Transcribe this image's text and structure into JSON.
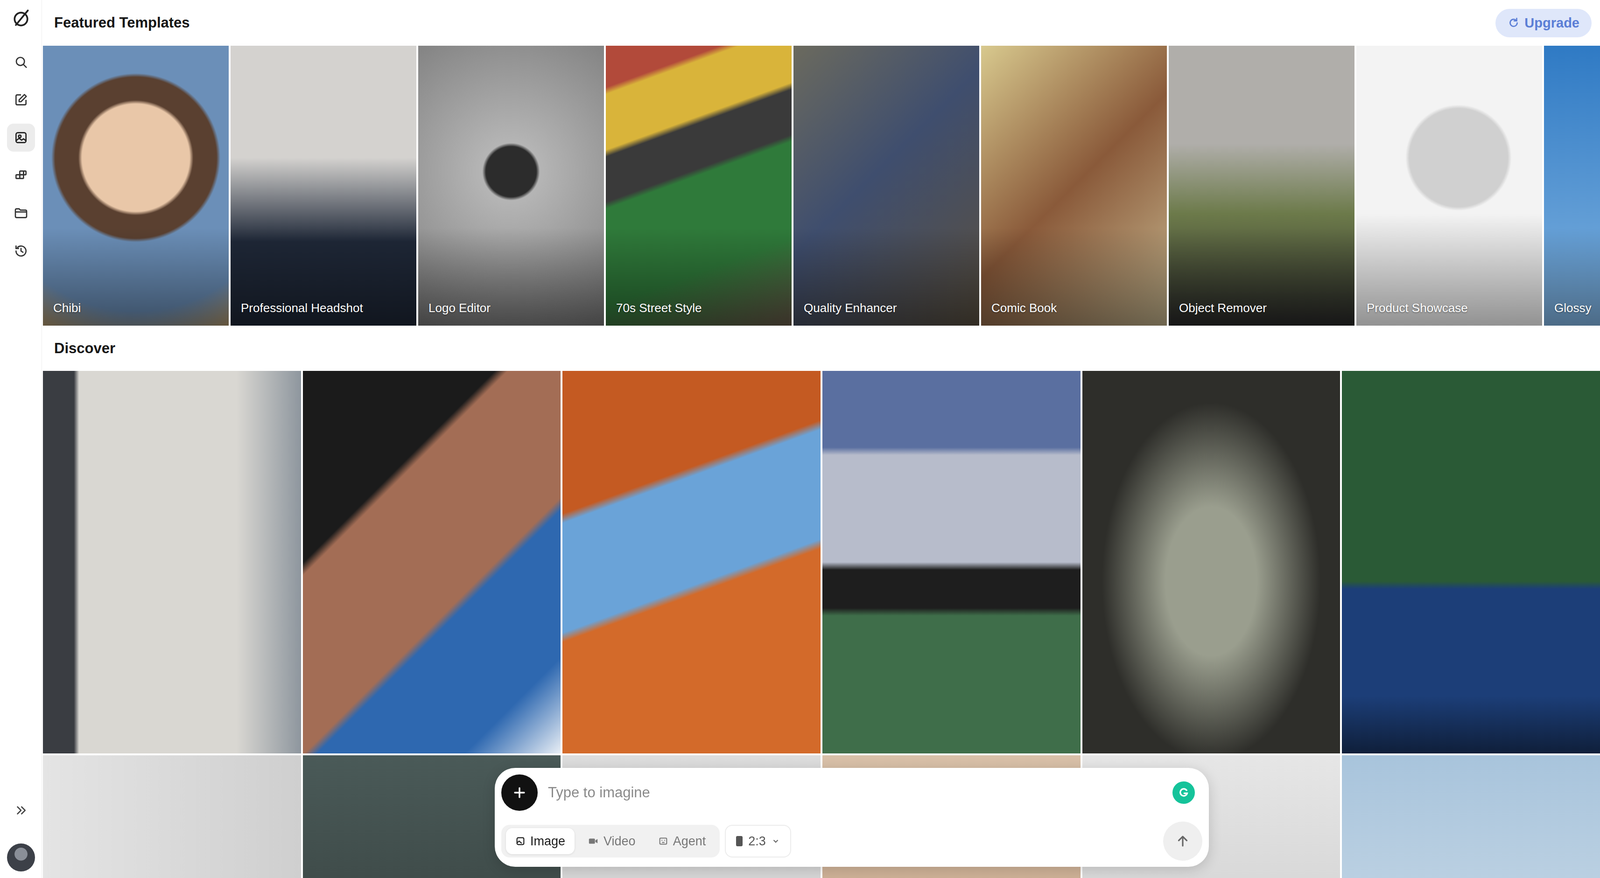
{
  "sidebar": {
    "items": [
      {
        "kind": "search",
        "selected": false
      },
      {
        "kind": "edit",
        "selected": false
      },
      {
        "kind": "templates",
        "selected": true
      },
      {
        "kind": "apps",
        "selected": false
      },
      {
        "kind": "folder",
        "selected": false
      },
      {
        "kind": "history",
        "selected": false
      }
    ]
  },
  "header": {
    "title": "Featured Templates",
    "upgrade": "Upgrade"
  },
  "templates": [
    {
      "label": "Chibi"
    },
    {
      "label": "Professional Headshot"
    },
    {
      "label": "Logo Editor"
    },
    {
      "label": "70s Street Style"
    },
    {
      "label": "Quality Enhancer"
    },
    {
      "label": "Comic Book"
    },
    {
      "label": "Object Remover"
    },
    {
      "label": "Product Showcase"
    },
    {
      "label": "Glossy"
    }
  ],
  "discover": {
    "title": "Discover"
  },
  "prompt": {
    "placeholder": "Type to imagine",
    "modes": [
      {
        "label": "Image",
        "kind": "image",
        "selected": true
      },
      {
        "label": "Video",
        "kind": "video",
        "selected": false
      },
      {
        "label": "Agent",
        "kind": "agent",
        "selected": false
      }
    ],
    "ratio": "2:3"
  }
}
